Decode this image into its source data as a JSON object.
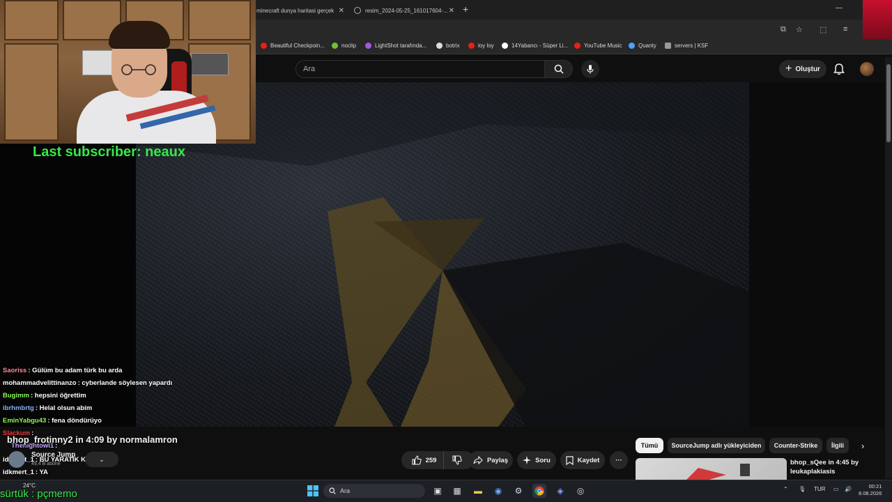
{
  "browser": {
    "tabs": [
      {
        "title": "minecraft dunya haritasi gerçek"
      },
      {
        "title": "resim_2024-05-25_161017604-..."
      }
    ],
    "new_tab": "+",
    "window_min": "—",
    "bookmarks": [
      {
        "label": "Beautiful Checkpoin...",
        "color": "#e62117"
      },
      {
        "label": "noclip",
        "color": "#6fbf3a"
      },
      {
        "label": "LightShot tarafında...",
        "color": "#a25ad9"
      },
      {
        "label": "botrix",
        "color": "#dddddd"
      },
      {
        "label": "loy loy",
        "color": "#e62117"
      },
      {
        "label": "14Yabancı - Süper Li...",
        "color": "#ffffff"
      },
      {
        "label": "YouTube Music",
        "color": "#e62117"
      },
      {
        "label": "Quanty",
        "color": "#4aa3ff"
      },
      {
        "label": "servers | KSF",
        "color": "#999999"
      }
    ]
  },
  "yt": {
    "search_placeholder": "Ara",
    "create_label": "Oluştur",
    "video_title": "bhop_frotinny2 in 4:09 by normalamron",
    "channel_name": "Source Jump",
    "channel_subs": "49,4 B abone",
    "like_count": "259",
    "share_label": "Paylaş",
    "ask_label": "Soru",
    "save_label": "Kaydet",
    "more_label": "···",
    "chips": [
      "Tümü",
      "SourceJump adlı yükleyiciden",
      "Counter-Strike",
      "İlgili"
    ],
    "rec_title": "bhop_sQee in 4:45 by leukaplakiasis"
  },
  "overlay": {
    "last_subscriber": "Last subscriber: neaux",
    "streamer_tag": "sürtük : pçmemo",
    "chat": [
      {
        "user": "Saoriss",
        "color": "#ff8aa0",
        "text": ": Gülüm bu adam türk bu arda"
      },
      {
        "user": "mohammadvelittinanzo",
        "color": "#ffffff",
        "text": ": cyberlande söylesen yapardı"
      },
      {
        "user": "Bugimm",
        "color": "#8dff5a",
        "text": ": hepsini öğrettim"
      },
      {
        "user": "ibrhmbrtg",
        "color": "#8ab4ff",
        "text": ": Helal olsun abim"
      },
      {
        "user": "EminYabgu43",
        "color": "#8dff5a",
        "text": ": fena döndürüyo"
      },
      {
        "user": "Slackum",
        "color": "#ff3a3a",
        "text": ":"
      },
      {
        "user": "Thenightowl1",
        "color": "#c9a6ff",
        "text": ":"
      },
      {
        "user": "idkmert_1",
        "color": "#ffffff",
        "text": ": BU YARATIK KİM AMK"
      },
      {
        "user": "idkmert_1",
        "color": "#ffffff",
        "text": ": YA"
      }
    ]
  },
  "taskbar": {
    "search_placeholder": "Ara",
    "weather": "24°C",
    "lang": "TUR",
    "time": "00:21",
    "date": "8.08.2026"
  }
}
